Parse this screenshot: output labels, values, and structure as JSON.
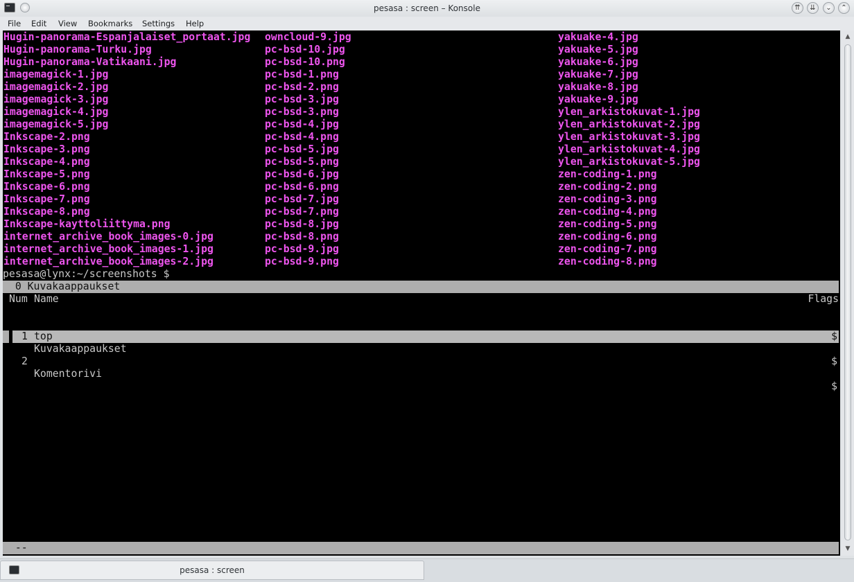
{
  "window": {
    "title": "pesasa : screen – Konsole",
    "buttons": {
      "keep_above": "⇈",
      "keep_below": "⇊",
      "minimize": "⌄",
      "maximize": "⌃",
      "close": "×"
    }
  },
  "menubar": {
    "items": [
      "File",
      "Edit",
      "View",
      "Bookmarks",
      "Settings",
      "Help"
    ]
  },
  "terminal": {
    "ls_rows": [
      [
        "Hugin-panorama-Espanjalaiset_portaat.jpg",
        "owncloud-9.jpg",
        "yakuake-4.jpg"
      ],
      [
        "Hugin-panorama-Turku.jpg",
        "pc-bsd-10.jpg",
        "yakuake-5.jpg"
      ],
      [
        "Hugin-panorama-Vatikaani.jpg",
        "pc-bsd-10.png",
        "yakuake-6.jpg"
      ],
      [
        "imagemagick-1.jpg",
        "pc-bsd-1.png",
        "yakuake-7.jpg"
      ],
      [
        "imagemagick-2.jpg",
        "pc-bsd-2.png",
        "yakuake-8.jpg"
      ],
      [
        "imagemagick-3.jpg",
        "pc-bsd-3.jpg",
        "yakuake-9.jpg"
      ],
      [
        "imagemagick-4.jpg",
        "pc-bsd-3.png",
        "ylen_arkistokuvat-1.jpg"
      ],
      [
        "imagemagick-5.jpg",
        "pc-bsd-4.jpg",
        "ylen_arkistokuvat-2.jpg"
      ],
      [
        "Inkscape-2.png",
        "pc-bsd-4.png",
        "ylen_arkistokuvat-3.jpg"
      ],
      [
        "Inkscape-3.png",
        "pc-bsd-5.jpg",
        "ylen_arkistokuvat-4.jpg"
      ],
      [
        "Inkscape-4.png",
        "pc-bsd-5.png",
        "ylen_arkistokuvat-5.jpg"
      ],
      [
        "Inkscape-5.png",
        "pc-bsd-6.jpg",
        "zen-coding-1.png"
      ],
      [
        "Inkscape-6.png",
        "pc-bsd-6.png",
        "zen-coding-2.png"
      ],
      [
        "Inkscape-7.png",
        "pc-bsd-7.jpg",
        "zen-coding-3.png"
      ],
      [
        "Inkscape-8.png",
        "pc-bsd-7.png",
        "zen-coding-4.png"
      ],
      [
        "Inkscape-kayttoliittyma.png",
        "pc-bsd-8.jpg",
        "zen-coding-5.png"
      ],
      [
        "internet_archive_book_images-0.jpg",
        "pc-bsd-8.png",
        "zen-coding-6.png"
      ],
      [
        "internet_archive_book_images-1.jpg",
        "pc-bsd-9.jpg",
        "zen-coding-7.png"
      ],
      [
        "internet_archive_book_images-2.jpg",
        "pc-bsd-9.png",
        "zen-coding-8.png"
      ]
    ],
    "prompt": "pesasa@lynx:~/screenshots $",
    "screen_title": "  0 Kuvakaappaukset",
    "header_num": "Num",
    "header_name": "Name",
    "header_flags": "Flags",
    "windows": [
      {
        "num": "0",
        "name": "Kuvakaappaukset",
        "flag": "$",
        "selected": false
      },
      {
        "num": "1",
        "name": "top",
        "flag": "$",
        "selected": true
      },
      {
        "num": "2",
        "name": "Komentorivi",
        "flag": "$",
        "selected": false
      }
    ],
    "status_line": "  --"
  },
  "tabs": [
    {
      "label": "pesasa : screen"
    }
  ],
  "colors": {
    "ls_text": "#ee55ee",
    "terminal_bg": "#000000",
    "bar_bg": "#aeaeae"
  }
}
